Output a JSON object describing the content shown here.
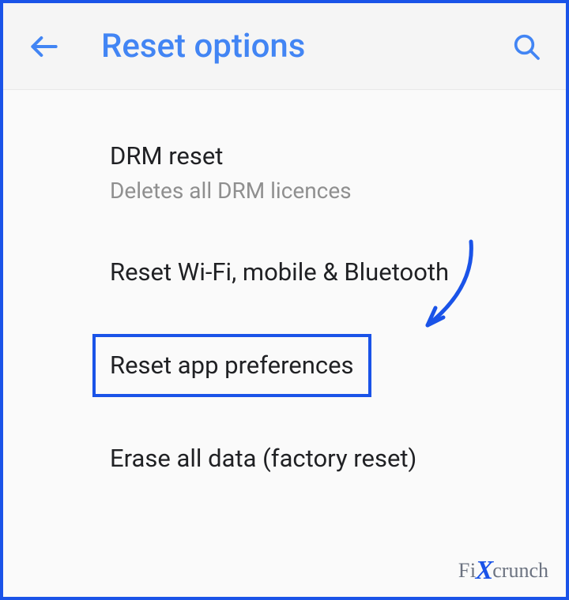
{
  "header": {
    "title": "Reset options"
  },
  "items": [
    {
      "title": "DRM reset",
      "subtitle": "Deletes all DRM licences"
    },
    {
      "title": "Reset Wi-Fi, mobile & Bluetooth"
    },
    {
      "title": "Reset app preferences"
    },
    {
      "title": "Erase all data (factory reset)"
    }
  ],
  "watermark": {
    "part1": "Fi",
    "part2": "X",
    "part3": "crunch"
  },
  "colors": {
    "accent": "#4285f4",
    "highlight": "#1a53e8",
    "text_primary": "#202124",
    "text_secondary": "#8f8f8f"
  }
}
